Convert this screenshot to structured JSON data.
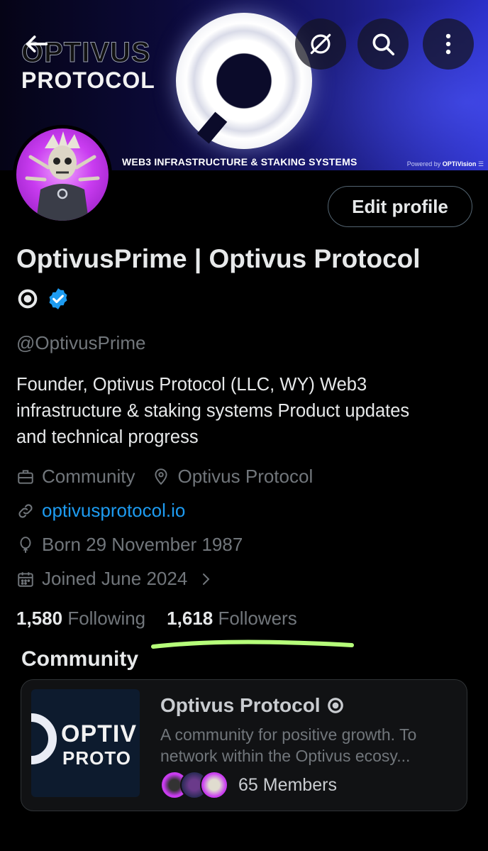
{
  "banner": {
    "logo_line1": "OPTIVUS",
    "logo_line2": "PROTOCOL",
    "tagline": "WEB3 INFRASTRUCTURE & STAKING SYSTEMS",
    "powered_prefix": "Powered by ",
    "powered_brand": "OPTiVision"
  },
  "toolbar": {
    "back_icon": "arrow-left-icon",
    "grok_icon": "slash-circle-icon",
    "search_icon": "search-icon",
    "more_icon": "more-vertical-icon"
  },
  "profile": {
    "edit_label": "Edit profile",
    "display_name": "OptivusPrime | Optivus Protocol",
    "handle": "@OptivusPrime",
    "bio_lines": [
      "Founder, Optivus Protocol (LLC, WY) Web3",
      "infrastructure & staking systems Product updates",
      "and technical progress"
    ],
    "category": "Community",
    "location": "Optivus Protocol",
    "website": "optivusprotocol.io",
    "birthday": "Born 29 November 1987",
    "joined": "Joined June 2024",
    "following_count": "1,580",
    "following_label": "Following",
    "followers_count": "1,618",
    "followers_label": "Followers",
    "verified_color": "#1d9bf0",
    "underline_color": "#b6ff7a"
  },
  "community": {
    "section_title": "Community",
    "thumb_line1": "OPTIV",
    "thumb_line2": "PROTO",
    "name": "Optivus Protocol",
    "desc_line1": "A community for positive growth. To",
    "desc_line2": "network within the Optivus ecosy...",
    "members": "65 Members"
  }
}
